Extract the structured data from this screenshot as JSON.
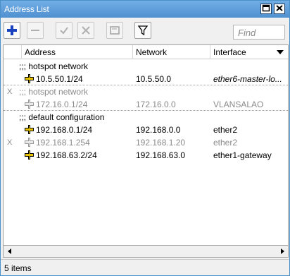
{
  "window": {
    "title": "Address List"
  },
  "titlebar_buttons": [
    "restore-icon",
    "close-icon"
  ],
  "toolbar": {
    "buttons": [
      {
        "icon": "plus-icon",
        "name": "add-button",
        "enabled": true
      },
      {
        "icon": "minus-icon",
        "name": "remove-button",
        "enabled": false
      },
      {
        "icon": "check-icon",
        "name": "enable-button",
        "enabled": false
      },
      {
        "icon": "x-icon",
        "name": "disable-button",
        "enabled": false
      },
      {
        "icon": "comment-icon",
        "name": "comment-button",
        "enabled": false
      },
      {
        "icon": "filter-icon",
        "name": "filter-button",
        "enabled": true
      }
    ],
    "find_placeholder": "Find"
  },
  "columns": {
    "address": "Address",
    "network": "Network",
    "interface": "Interface"
  },
  "rows": [
    {
      "type": "comment",
      "flag": "",
      "text": ";;; hotspot network",
      "disabled": false
    },
    {
      "type": "entry",
      "flag": "",
      "address": "10.5.50.1/24",
      "network": "10.5.50.0",
      "interface": "ether6-master-lo...",
      "disabled": false,
      "italic_iface": true
    },
    {
      "type": "comment",
      "flag": "X",
      "text": ";;; hotspot network",
      "disabled": true
    },
    {
      "type": "entry",
      "flag": "",
      "address": "172.16.0.1/24",
      "network": "172.16.0.0",
      "interface": "VLANSALAO",
      "disabled": true,
      "italic_iface": false
    },
    {
      "type": "comment",
      "flag": "",
      "text": ";;; default configuration",
      "disabled": false
    },
    {
      "type": "entry",
      "flag": "",
      "address": "192.168.0.1/24",
      "network": "192.168.0.0",
      "interface": "ether2",
      "disabled": false,
      "italic_iface": false
    },
    {
      "type": "entry",
      "flag": "X",
      "address": "192.168.1.254",
      "network": "192.168.1.20",
      "interface": "ether2",
      "disabled": true,
      "italic_iface": false
    },
    {
      "type": "entry",
      "flag": "",
      "address": "192.168.63.2/24",
      "network": "192.168.63.0",
      "interface": "ether1-gateway",
      "disabled": false,
      "italic_iface": false
    }
  ],
  "status": {
    "text": "5 items"
  },
  "colors": {
    "titlebar": "#4f90d0",
    "add_icon": "#1a3fbf",
    "address_icon": "#e6c200",
    "disabled_text": "#8a8a8a"
  }
}
